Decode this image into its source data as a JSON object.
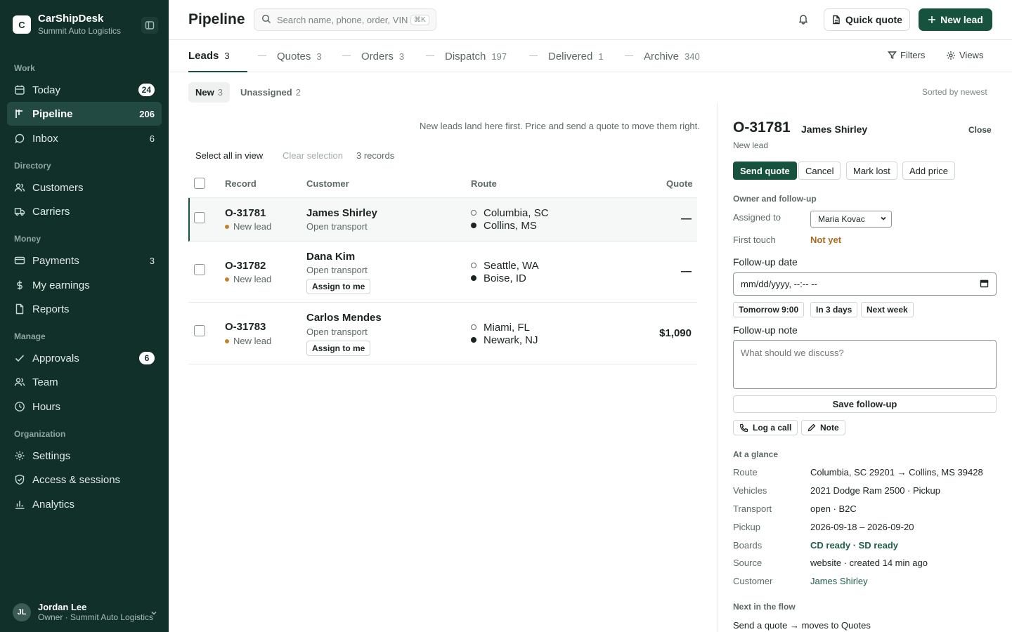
{
  "app": {
    "name": "CarShipDesk",
    "org": "Summit Auto Logistics",
    "logo_letter": "C"
  },
  "sidebar": {
    "sections": [
      "Work",
      "Directory",
      "Money",
      "Manage",
      "Organization"
    ],
    "items": [
      {
        "label": "Today",
        "count": "24",
        "icon": "calendar-icon"
      },
      {
        "label": "Pipeline",
        "count": "206",
        "icon": "pipeline-icon"
      },
      {
        "label": "Inbox",
        "count": "6",
        "icon": "chat-icon"
      },
      {
        "label": "Customers",
        "count": "",
        "icon": "users-icon"
      },
      {
        "label": "Carriers",
        "count": "",
        "icon": "truck-icon"
      },
      {
        "label": "Payments",
        "count": "3",
        "icon": "card-icon"
      },
      {
        "label": "My earnings",
        "count": "",
        "icon": "dollar-icon"
      },
      {
        "label": "Reports",
        "count": "",
        "icon": "document-icon"
      },
      {
        "label": "Approvals",
        "count": "6",
        "icon": "check-icon"
      },
      {
        "label": "Team",
        "count": "",
        "icon": "team-icon"
      },
      {
        "label": "Hours",
        "count": "",
        "icon": "clock-icon"
      },
      {
        "label": "Settings",
        "count": "",
        "icon": "gear-icon"
      },
      {
        "label": "Access & sessions",
        "count": "",
        "icon": "shield-icon"
      },
      {
        "label": "Analytics",
        "count": "",
        "icon": "bar-chart-icon"
      }
    ],
    "user": {
      "initials": "JL",
      "name": "Jordan Lee",
      "role": "Owner · Summit Auto Logistics"
    }
  },
  "header": {
    "title": "Pipeline",
    "search_placeholder": "Search name, phone, order, VIN",
    "search_shortcut": "⌘K",
    "quick_quote": "Quick quote",
    "new_lead": "New lead"
  },
  "tabs": [
    {
      "label": "Leads",
      "count": "3"
    },
    {
      "label": "Quotes",
      "count": "3"
    },
    {
      "label": "Orders",
      "count": "3"
    },
    {
      "label": "Dispatch",
      "count": "197"
    },
    {
      "label": "Delivered",
      "count": "1"
    },
    {
      "label": "Archive",
      "count": "340"
    }
  ],
  "tools": {
    "filters": "Filters",
    "views": "Views"
  },
  "subtabs": [
    {
      "label": "New",
      "count": "3"
    },
    {
      "label": "Unassigned",
      "count": "2"
    }
  ],
  "sorted": "Sorted by newest",
  "list": {
    "hint": "New leads land here first. Price and send a quote to move them right.",
    "select_all": "Select all in view",
    "clear_selection": "Clear selection",
    "record_count": "3 records",
    "columns": [
      "Record",
      "Customer",
      "Route",
      "Quote"
    ],
    "assign_label": "Assign to me",
    "rows": [
      {
        "id": "O-31781",
        "status": "New lead",
        "customer": "James Shirley",
        "transport": "Open transport",
        "from": "Columbia, SC",
        "to": "Collins, MS",
        "quote": "—"
      },
      {
        "id": "O-31782",
        "status": "New lead",
        "customer": "Dana Kim",
        "transport": "Open transport",
        "from": "Seattle, WA",
        "to": "Boise, ID",
        "quote": "—"
      },
      {
        "id": "O-31783",
        "status": "New lead",
        "customer": "Carlos Mendes",
        "transport": "Open transport",
        "from": "Miami, FL",
        "to": "Newark, NJ",
        "quote": "$1,090"
      }
    ]
  },
  "detail": {
    "id": "O-31781",
    "name": "James Shirley",
    "close": "Close",
    "stage": "New lead",
    "actions": {
      "send_quote": "Send quote",
      "cancel": "Cancel",
      "mark_lost": "Mark lost",
      "add_price": "Add price"
    },
    "owner_section": "Owner and follow-up",
    "assigned_label": "Assigned to",
    "assigned_value": "Maria Kovac",
    "first_touch_label": "First touch",
    "first_touch_value": "Not yet",
    "followup_date_label": "Follow-up date",
    "followup_date_value": "mm/dd/yyyy, --:-- --",
    "quick_dates": [
      "Tomorrow 9:00",
      "In 3 days",
      "Next week"
    ],
    "followup_note_label": "Follow-up note",
    "followup_note_placeholder": "What should we discuss?",
    "save_followup": "Save follow-up",
    "log_call": "Log a call",
    "note": "Note",
    "glance_section": "At a glance",
    "glance": [
      {
        "label": "Route",
        "value": "Columbia, SC 29201 → Collins, MS 39428"
      },
      {
        "label": "Vehicles",
        "value": "2021 Dodge Ram 2500 · Pickup"
      },
      {
        "label": "Transport",
        "value": "open · B2C"
      },
      {
        "label": "Pickup",
        "value": "2026-09-18 – 2026-09-20"
      },
      {
        "label": "Boards",
        "value": "CD ready · SD ready"
      },
      {
        "label": "Source",
        "value": "website · created 14 min ago"
      },
      {
        "label": "Customer",
        "value": "James Shirley"
      }
    ],
    "next_section": "Next in the flow",
    "next_text": "Send a quote → moves to Quotes"
  },
  "colors": {
    "sidebar": "#12302a",
    "accent": "#17523f",
    "amber": "#c5822b"
  }
}
